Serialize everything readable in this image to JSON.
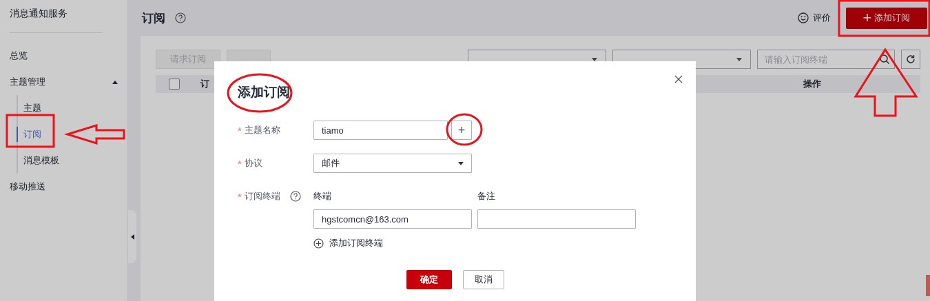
{
  "sidebar": {
    "title": "消息通知服务",
    "items": [
      {
        "label": "总览",
        "selected": false
      },
      {
        "label": "主题管理",
        "selected": false,
        "expanded": true,
        "children": [
          {
            "label": "主题",
            "selected": false
          },
          {
            "label": "订阅",
            "selected": true
          },
          {
            "label": "消息模板",
            "selected": false
          }
        ]
      },
      {
        "label": "移动推送",
        "selected": false
      }
    ]
  },
  "header": {
    "title": "订阅",
    "rate_link": "评价",
    "add_button": {
      "icon": "+",
      "label": "添加订阅"
    }
  },
  "toolbar": {
    "buttons": [
      {
        "label": "请求订阅",
        "disabled": true
      },
      {
        "disabled": true
      }
    ],
    "filters": [
      {
        "kind": "dropdown"
      },
      {
        "kind": "dropdown"
      }
    ],
    "search": {
      "placeholder": "请输入订阅终端"
    }
  },
  "table": {
    "select_all": {
      "checked": false
    },
    "columns": [
      "订",
      "操作"
    ]
  },
  "dialog": {
    "title": "添加订阅",
    "fields": [
      {
        "kind": "topic",
        "label": "主题名称",
        "required_mark": "*",
        "value": "tiamo",
        "add_icon": "+"
      },
      {
        "kind": "select",
        "label": "协议",
        "required_mark": "*",
        "value": "邮件"
      },
      {
        "kind": "endpoints",
        "label": "订阅终端",
        "required_mark": "*",
        "columns": [
          "终端",
          "备注"
        ],
        "rows": [
          {
            "endpoint": "hgstcomcn@163.com"
          }
        ],
        "add_link": "添加订阅终端"
      }
    ],
    "buttons": [
      {
        "label": "确定",
        "kind": "primary"
      },
      {
        "label": "取消",
        "kind": "secondary"
      }
    ]
  },
  "annotations": [
    {
      "kind": "frame"
    },
    {
      "kind": "arrow"
    },
    {
      "kind": "ellipse"
    },
    {
      "kind": "ellipse"
    },
    {
      "kind": "frame"
    },
    {
      "kind": "arrow"
    }
  ]
}
